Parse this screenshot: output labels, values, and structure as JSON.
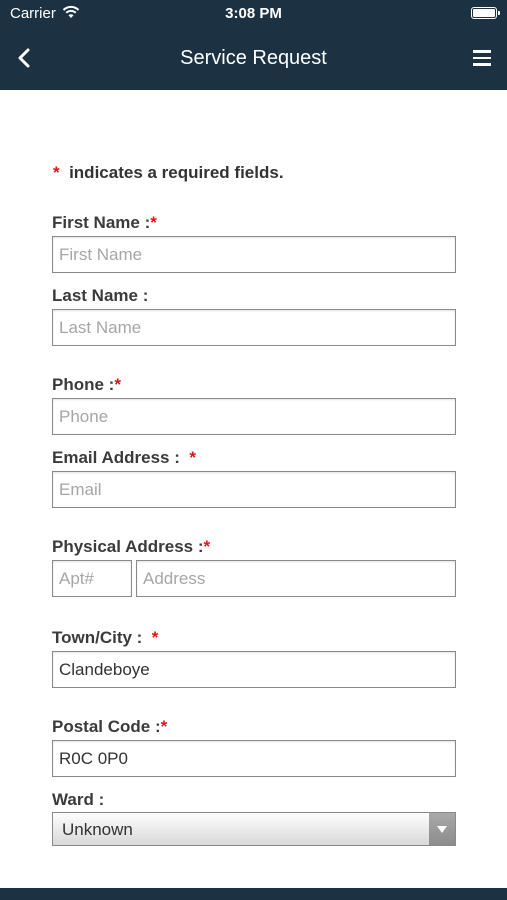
{
  "status_bar": {
    "carrier": "Carrier",
    "time": "3:08 PM"
  },
  "nav": {
    "title": "Service Request"
  },
  "form": {
    "required_star": "*",
    "required_note": "indicates a required fields.",
    "first_name": {
      "label": "First Name :",
      "placeholder": "First Name",
      "value": ""
    },
    "last_name": {
      "label": "Last Name :",
      "placeholder": "Last Name",
      "value": ""
    },
    "phone": {
      "label": "Phone :",
      "placeholder": "Phone",
      "value": ""
    },
    "email": {
      "label": "Email Address :",
      "placeholder": "Email",
      "value": ""
    },
    "physical_address": {
      "label": "Physical Address :",
      "apt_placeholder": "Apt#",
      "address_placeholder": "Address"
    },
    "town": {
      "label": "Town/City :",
      "value": "Clandeboye"
    },
    "postal": {
      "label": "Postal Code :",
      "value": "R0C 0P0"
    },
    "ward": {
      "label": "Ward :",
      "selected": "Unknown"
    }
  },
  "colors": {
    "header_bg": "#1c3243",
    "required": "#e0131a"
  },
  "icons": {
    "back": "chevron-left-icon",
    "menu": "hamburger-menu-icon",
    "wifi": "wifi-icon",
    "battery": "battery-icon"
  }
}
